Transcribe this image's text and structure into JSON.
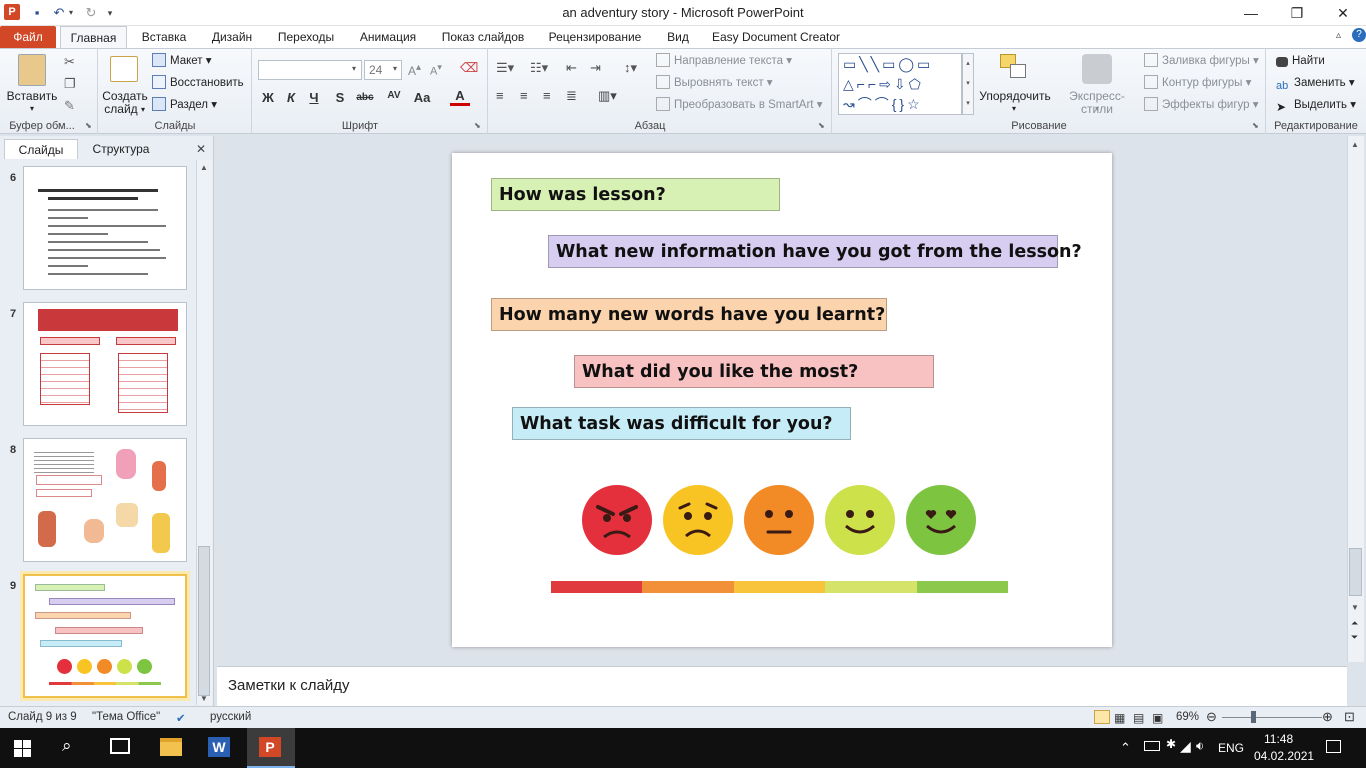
{
  "window": {
    "title": "an adventury story  -  Microsoft PowerPoint",
    "minimize": "—",
    "maximize": "❐",
    "close": "✕"
  },
  "ribbon_tabs": [
    "Файл",
    "Главная",
    "Вставка",
    "Дизайн",
    "Переходы",
    "Анимация",
    "Показ слайдов",
    "Рецензирование",
    "Вид",
    "Easy Document Creator"
  ],
  "ribbon": {
    "clipboard": {
      "paste": "Вставить",
      "label": "Буфер обм..."
    },
    "slides": {
      "new_slide_1": "Создать",
      "new_slide_2": "слайд",
      "layout": "Макет",
      "reset": "Восстановить",
      "section": "Раздел",
      "label": "Слайды"
    },
    "font": {
      "font_name": "",
      "font_size": "24",
      "label": "Шрифт",
      "bold": "Ж",
      "italic": "К",
      "underline": "Ч",
      "shadow": "S",
      "strike": "abc",
      "spacing": "AV",
      "case": "Aa",
      "color": "A"
    },
    "paragraph": {
      "text_direction": "Направление текста",
      "align_text": "Выровнять текст",
      "smartart": "Преобразовать в SmartArt",
      "label": "Абзац"
    },
    "drawing": {
      "arrange": "Упорядочить",
      "quick_styles": "Экспресс-стили",
      "fill": "Заливка фигуры",
      "outline": "Контур фигуры",
      "effects": "Эффекты фигур",
      "label": "Рисование"
    },
    "editing": {
      "find": "Найти",
      "replace": "Заменить",
      "select": "Выделить",
      "label": "Редактирование"
    }
  },
  "left_panel": {
    "tab_slides": "Слайды",
    "tab_outline": "Структура",
    "close": "✕",
    "slides": [
      {
        "number": "6"
      },
      {
        "number": "7"
      },
      {
        "number": "8"
      },
      {
        "number": "9"
      }
    ]
  },
  "slide": {
    "questions": [
      {
        "text": "How was lesson?",
        "color": "#d7f0b4"
      },
      {
        "text": "What new information have you got from the lesson?",
        "color": "#d6cdf0"
      },
      {
        "text": "How many new words have you learnt?",
        "color": "#fbd3ac"
      },
      {
        "text": "What did you like the most?",
        "color": "#f8c2c3"
      },
      {
        "text": "What task was difficult  for you?",
        "color": "#c6ecf7"
      }
    ],
    "faces": [
      {
        "name": "angry",
        "color": "#e4303c"
      },
      {
        "name": "sad",
        "color": "#f7c424"
      },
      {
        "name": "neutral",
        "color": "#f28a25"
      },
      {
        "name": "smile",
        "color": "#cde14b"
      },
      {
        "name": "love",
        "color": "#7dc440"
      }
    ],
    "scale_colors": [
      "#e03a3e",
      "#f2903a",
      "#f7c43c",
      "#d6e36b",
      "#8cc84b"
    ]
  },
  "notes": {
    "placeholder": "Заметки к слайду"
  },
  "status": {
    "slide_info": "Слайд 9 из 9",
    "theme": "\"Тема Office\"",
    "language": "русский",
    "zoom": "69%"
  },
  "taskbar": {
    "lang": "ENG",
    "time": "11:48",
    "date": "04.02.2021"
  }
}
